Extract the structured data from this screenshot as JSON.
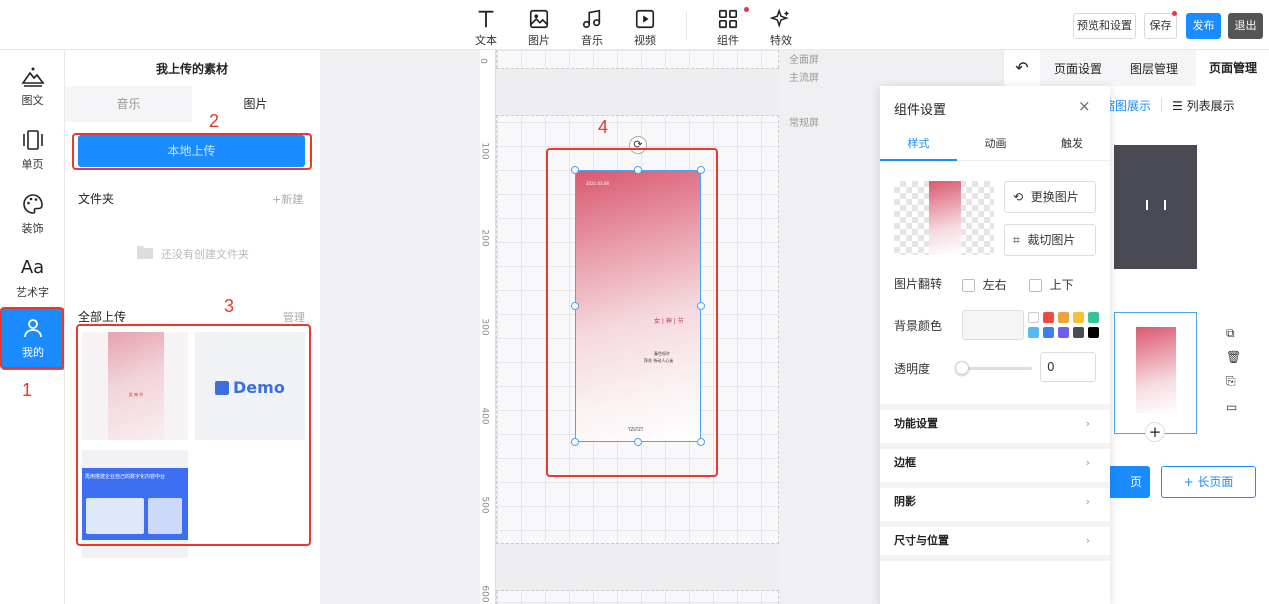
{
  "toolbar": {
    "tools": [
      "文本",
      "图片",
      "音乐",
      "视频",
      "组件",
      "特效"
    ],
    "preview_label": "预览和设置",
    "save_label": "保存",
    "publish_label": "发布",
    "exit_label": "退出"
  },
  "rail": {
    "items": [
      "图文",
      "单页",
      "装饰",
      "艺术字",
      "我的"
    ]
  },
  "assets": {
    "title": "我上传的素材",
    "tab_music": "音乐",
    "tab_image": "图片",
    "upload_label": "本地上传",
    "folder_label": "文件夹",
    "new_label": "+新建",
    "empty_folder": "还没有创建文件夹",
    "all_uploads": "全部上传",
    "manage": "管理",
    "demo_text": "Demo",
    "banner_title": "再用搭建企业自己的数字化内容中台",
    "poster_mini": "女 神 节"
  },
  "annotations": [
    "1",
    "2",
    "3",
    "4"
  ],
  "canvas": {
    "label_full": "全面屏",
    "label_main": "主流屏",
    "label_normal": "常规屏",
    "ruler": [
      "0",
      "100",
      "200",
      "300",
      "400",
      "500",
      "600"
    ],
    "poster_title": "女 | 神 | 节",
    "poster_date": "2021.03.08",
    "poster_sub1": "春色如许",
    "poster_sub2": "拜花 待动人心迷",
    "poster_brand": "TZSTZT"
  },
  "component": {
    "title": "组件设置",
    "tabs": [
      "样式",
      "动画",
      "触发"
    ],
    "replace_image": "更换图片",
    "crop_image": "裁切图片",
    "flip_label": "图片翻转",
    "flip_lr": "左右",
    "flip_ud": "上下",
    "bg_label": "背景颜色",
    "opacity_label": "透明度",
    "opacity_value": "0",
    "sections": [
      "功能设置",
      "边框",
      "阴影",
      "尺寸与位置"
    ],
    "swatches": [
      "#ffffff",
      "#f04a44",
      "#f0a23b",
      "#f3c233",
      "#33c49b",
      "#55b8f3",
      "#3b7ff0",
      "#6b5ef0",
      "#4a4a55",
      "#000000"
    ]
  },
  "page_panel": {
    "tabs": [
      "页面设置",
      "图层管理",
      "页面管理"
    ],
    "view_grid": "缩图展示",
    "view_list": "列表展示",
    "page_btn": "页",
    "long_page_btn": "+ 长页面"
  }
}
